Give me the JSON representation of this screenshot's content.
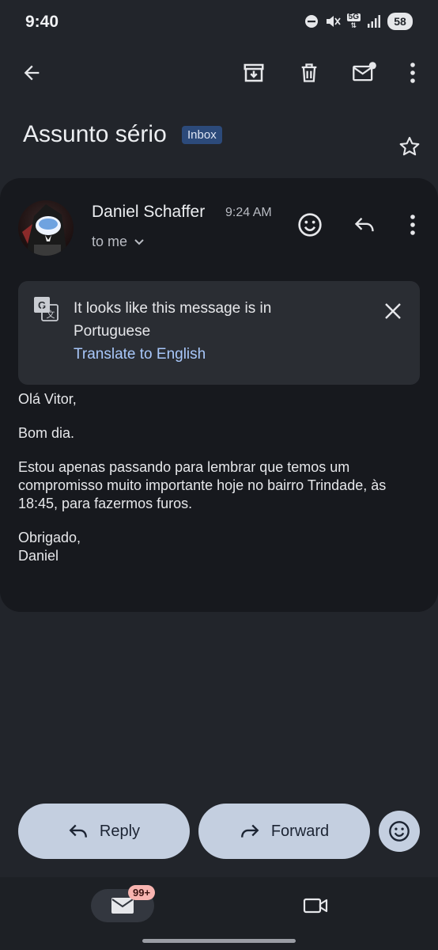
{
  "status_bar": {
    "time": "9:40",
    "network": "5G",
    "battery": "58",
    "icons": [
      "dnd-icon",
      "mute-icon",
      "signal-icon"
    ]
  },
  "toolbar": {
    "icons": [
      "back-arrow-icon",
      "archive-icon",
      "delete-icon",
      "mark-unread-icon",
      "more-vert-icon"
    ]
  },
  "email": {
    "subject": "Assunto sério",
    "label": "Inbox",
    "sender": "Daniel Schaffer",
    "time": "9:24 AM",
    "recipient": "to me",
    "translate": {
      "message": "It looks like this message is in Portuguese",
      "link": "Translate to English"
    },
    "body": {
      "greeting": "Olá Vitor,",
      "line1": "Bom dia.",
      "line2": "Estou apenas passando para lembrar que temos um compromisso muito importante hoje no bairro Trindade, às 18:45, para fazermos furos.",
      "closing": "Obrigado,",
      "signature": "Daniel"
    }
  },
  "actions": {
    "reply": "Reply",
    "forward": "Forward"
  },
  "bottom_nav": {
    "mail_badge": "99+"
  },
  "colors": {
    "background": "#22252b",
    "card": "#17191e",
    "accent_link": "#a8c7fa",
    "pill": "#c4cfe0",
    "badge": "#f8b4b0"
  }
}
